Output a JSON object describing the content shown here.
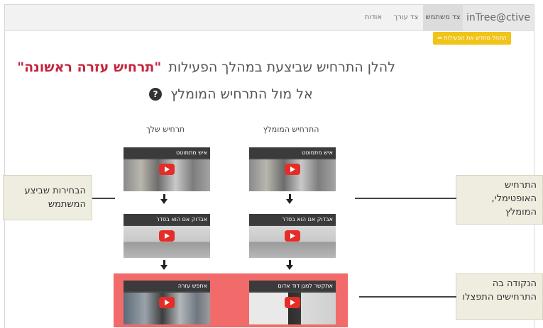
{
  "navbar": {
    "brand": "inTree@ctive",
    "tabs": [
      {
        "label": "צד משתמש",
        "active": true
      },
      {
        "label": "צד עורך",
        "active": false
      },
      {
        "label": "אודות",
        "active": false
      }
    ]
  },
  "restart_button": "התחל מחדש את הפעילות",
  "heading": {
    "line1_prefix": "להלן התרחיש שביצעת במהלך הפעילות",
    "line1_highlight": "\"תרחיש עזרה ראשונה\"",
    "line2": "אל מול התרחיש המומלץ"
  },
  "columns": {
    "recommended": "התרחיש המומלץ",
    "yours": "תרחיש שלך"
  },
  "recommended_steps": [
    "איש מתמוטט",
    "אבדוק אם הוא בסדר",
    "אתקשר למגן דוד אדום"
  ],
  "user_steps": [
    "איש מתמוטט",
    "אבדוק אם הוא בסדר",
    "אחפש עזרה"
  ],
  "callouts": {
    "user_choices": "הבחירות שביצע המשתמש",
    "optimal": "התרחיש האופטימלי, המומלץ",
    "divergence": "הנקודה בה התרחישים התפצלו"
  },
  "colors": {
    "highlight": "#c7243c",
    "divergence_bg": "#f26b6b",
    "button": "#f0c419",
    "play": "#e52d27"
  }
}
